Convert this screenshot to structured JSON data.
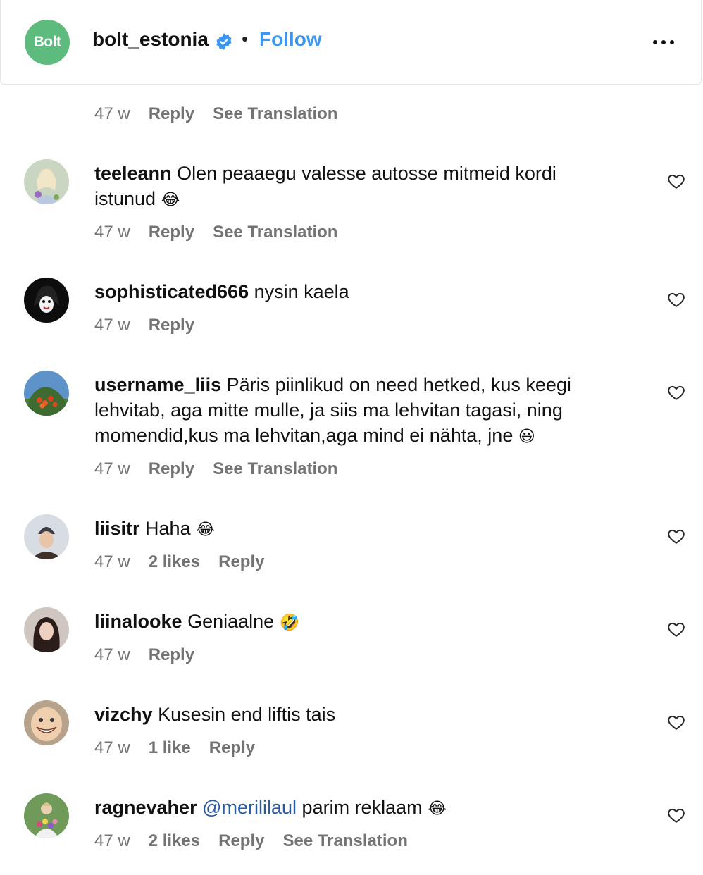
{
  "header": {
    "brand_text": "Bolt",
    "username": "bolt_estonia",
    "separator": "•",
    "follow_label": "Follow"
  },
  "top_partial": {
    "time": "47 w",
    "reply": "Reply",
    "translate": "See Translation"
  },
  "comments": [
    {
      "user": "teeleann",
      "text": "Olen peaaegu valesse autosse mitmeid kordi istunud",
      "emoji": "😂",
      "time": "47 w",
      "reply": "Reply",
      "translate": "See Translation"
    },
    {
      "user": "sophisticated666",
      "text": "nysin kaela",
      "time": "47 w",
      "reply": "Reply"
    },
    {
      "user": "username_liis",
      "text": "Päris piinlikud on need hetked, kus keegi lehvitab, aga mitte mulle, ja siis ma lehvitan tagasi, ning momendid,kus ma lehvitan,aga mind ei nähta, jne",
      "emoji": "😃",
      "time": "47 w",
      "reply": "Reply",
      "translate": "See Translation"
    },
    {
      "user": "liisitr",
      "text": "Haha",
      "emoji": "😂",
      "time": "47 w",
      "likes": "2 likes",
      "reply": "Reply"
    },
    {
      "user": "liinalooke",
      "text": "Geniaalne",
      "emoji": "🤣",
      "time": "47 w",
      "reply": "Reply"
    },
    {
      "user": "vizchy",
      "text": "Kusesin end liftis tais",
      "time": "47 w",
      "likes": "1 like",
      "reply": "Reply"
    },
    {
      "user": "ragnevaher",
      "mention": "@merililaul",
      "text": "parim reklaam",
      "emoji": "😂",
      "time": "47 w",
      "likes": "2 likes",
      "reply": "Reply",
      "translate": "See Translation"
    }
  ],
  "colors": {
    "accent": "#3b97f0",
    "brand": "#5dbb7e",
    "meta": "#737373",
    "mention": "#2b5aa0"
  }
}
